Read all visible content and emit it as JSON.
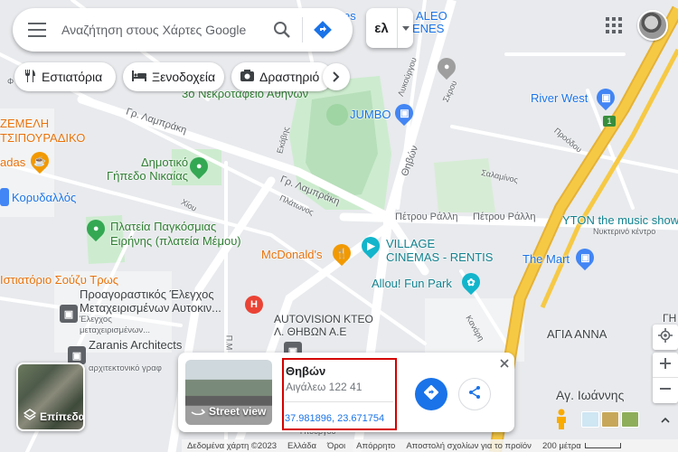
{
  "search": {
    "placeholder": "Αναζήτηση στους Χάρτες Google"
  },
  "language": {
    "label": "ελ"
  },
  "chips": [
    {
      "label": "Εστιατόρια",
      "icon": "restaurant-icon"
    },
    {
      "label": "Ξενοδοχεία",
      "icon": "hotel-icon"
    },
    {
      "label": "Δραστηριό",
      "icon": "camera-icon"
    }
  ],
  "map_labels": {
    "top_leo": "ALEO",
    "top_nes": "ENES",
    "top_es": "es",
    "cemetery": "3ο Νεκροταφείο Αθηνών",
    "jumbo": "JUMBO",
    "river_west": "River West",
    "zemeli": "ΖΕΜΕΛΗ",
    "tsipouradiko": "ΤΣΙΠΟΥΡΑΔΙΚΟ",
    "ladas": "adas",
    "stadium": "Δημοτικό\nΓήπεδο Νικαίας",
    "road_lambraki1": "Γρ. Λαμπράκη",
    "road_lambraki2": "Γρ. Λαμπράκη",
    "road_thivon": "Θηβών",
    "road_ralli1": "Πέτρου Ράλλη",
    "road_ralli2": "Πέτρου Ράλλη",
    "road_lykourgou": "Λυκούργου",
    "road_skrou": "Σκρου",
    "road_salaminos": "Σαλαμίνος",
    "road_proodou": "Προόδου",
    "road_platonos": "Πλάτωνος",
    "road_xiou": "Χίου",
    "road_ekavis": "Εκάβης",
    "road_kanari": "Κανάρη",
    "road_fikiou": "Φ",
    "korydallos": "Κορυδαλλός",
    "plateia": "Πλατεία Παγκόσμιας\nΕιρήνης (πλατεία Μέμου)",
    "mcdonalds": "McDonald's",
    "village": "VILLAGE\nCINEMAS - RENTIS",
    "allou": "Allou! Fun Park",
    "ytong": "YTON the music show",
    "ytong_sub": "Νυκτερινό κέντρο",
    "mart": "The Mart",
    "school": "Ιστιατόριο Σούζυ Τρως",
    "proagorastikos": "Προαγοραστικός Έλεγχος\nΜεταχειρισμένων Αυτοκιν...",
    "proag_sub": "Έλεγχος\nμεταχειρισμένων...",
    "zaranis": "Zaranis Architects",
    "zaranis_sub": "αρχιτεκτονικό γραφ",
    "autovision": "AUTOVISION KTEO\nΛ. ΘΗΒΩΝ Α.Ε",
    "agia_anna": "ΑΓΙΑ ΑΝΝΑ",
    "ag_ioannis": "Αγ. Ιωάννης",
    "gi": "ΓΗ",
    "pm": "Π.Μ",
    "ypourgou": "Υπουργου",
    "highway_shield": "1"
  },
  "layers": {
    "label": "Επίπεδα"
  },
  "info_card": {
    "title": "Θηβών",
    "subtitle": "Αιγάλεω 122 41",
    "coordinates": "37.981896, 23.671754",
    "street_view_label": "Street view"
  },
  "footer": {
    "data": "Δεδομένα χάρτη ©2023",
    "country": "Ελλάδα",
    "terms": "Όροι",
    "privacy": "Απόρρητο",
    "feedback": "Αποστολή σχολίων για το προϊόν",
    "scale": "200 μέτρα"
  },
  "colors": {
    "accent": "#1a73e8",
    "highlight": "#d50000",
    "highway": "#f6c945"
  }
}
